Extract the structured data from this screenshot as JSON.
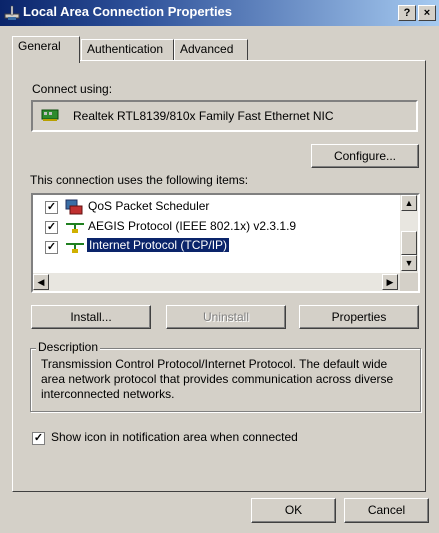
{
  "window": {
    "title": "Local Area Connection Properties",
    "help_button": "?",
    "close_button": "×"
  },
  "tabs": [
    {
      "label": "General",
      "active": true
    },
    {
      "label": "Authentication",
      "active": false
    },
    {
      "label": "Advanced",
      "active": false
    }
  ],
  "connect_using": {
    "label": "Connect using:",
    "adapter": "Realtek RTL8139/810x Family Fast Ethernet NIC",
    "configure_button": "Configure..."
  },
  "items_label": "This connection uses the following items:",
  "items": [
    {
      "label": "QoS Packet Scheduler",
      "checked": true,
      "icon": "scheduler-icon",
      "selected": false
    },
    {
      "label": "AEGIS Protocol (IEEE 802.1x) v2.3.1.9",
      "checked": true,
      "icon": "network-protocol-icon",
      "selected": false
    },
    {
      "label": "Internet Protocol (TCP/IP)",
      "checked": true,
      "icon": "network-protocol-icon",
      "selected": true
    }
  ],
  "item_buttons": {
    "install": "Install...",
    "uninstall": "Uninstall",
    "properties": "Properties"
  },
  "description": {
    "legend": "Description",
    "text": "Transmission Control Protocol/Internet Protocol. The default wide area network protocol that provides communication across diverse interconnected networks."
  },
  "show_icon": {
    "label": "Show icon in notification area when connected",
    "checked": true
  },
  "footer": {
    "ok": "OK",
    "cancel": "Cancel"
  },
  "colors": {
    "title_gradient_start": "#0a246a",
    "title_gradient_end": "#a6caf0",
    "face": "#d4d0c8",
    "selection": "#0a246a"
  }
}
